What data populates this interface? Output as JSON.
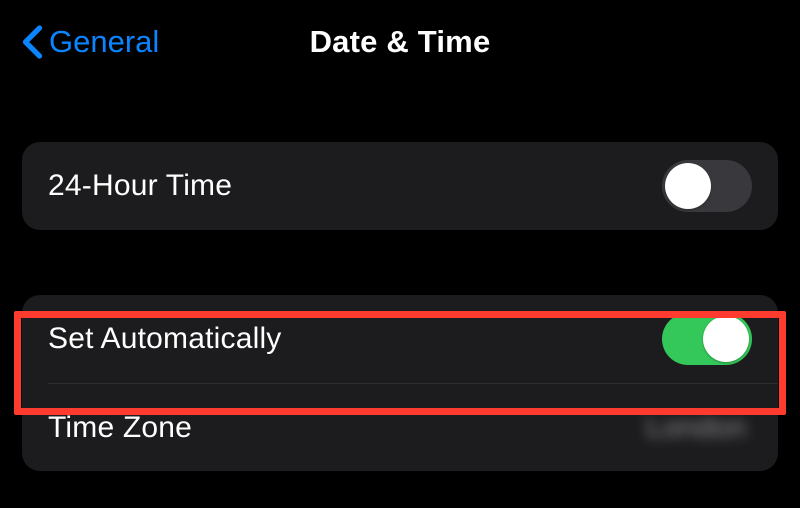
{
  "nav": {
    "back_label": "General",
    "title": "Date & Time"
  },
  "rows": {
    "twentyFourHour": {
      "label": "24-Hour Time"
    },
    "setAuto": {
      "label": "Set Automatically"
    },
    "timeZone": {
      "label": "Time Zone",
      "value": "London"
    }
  }
}
